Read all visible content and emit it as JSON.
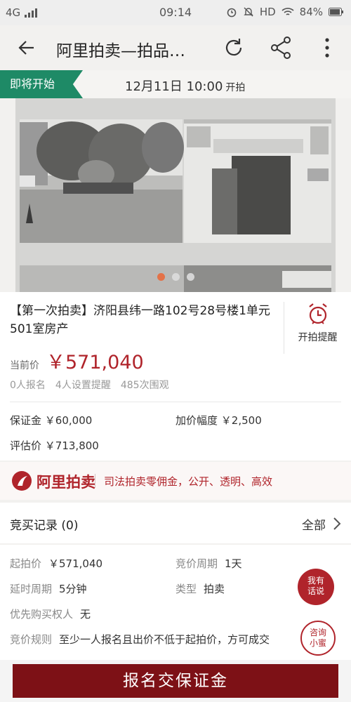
{
  "status_bar": {
    "network": "4G",
    "time": "09:14",
    "hd": "HD",
    "battery": "84%"
  },
  "title_bar": {
    "title": "阿里拍卖—拍品…"
  },
  "banner": {
    "badge": "即将开始",
    "start_time": "12月11日  10:00",
    "start_suffix": "开拍"
  },
  "lot": {
    "title": "【第一次拍卖】济阳县纬一路102号28号楼1单元501室房产",
    "remind_label": "开拍提醒",
    "current_price_label": "当前价",
    "current_price": "￥571,040",
    "stats": [
      "0人报名",
      "4人设置提醒",
      "485次围观"
    ],
    "deposit_label": "保证金",
    "deposit": "￥60,000",
    "increment_label": "加价幅度",
    "increment": "￥2,500",
    "appraisal_label": "评估价",
    "appraisal": "￥713,800",
    "photo_count": 3,
    "photo_index": 1
  },
  "brand": {
    "name": "阿里拍卖",
    "slogan": "司法拍卖零佣金，公开、透明、高效"
  },
  "records": {
    "title": "竞买记录",
    "count": "(0)",
    "all": "全部"
  },
  "details": {
    "start_price_label": "起拍价",
    "start_price": "￥571,040",
    "cycle_label": "竞价周期",
    "cycle": "1天",
    "delay_label": "延时周期",
    "delay": "5分钟",
    "type_label": "类型",
    "type": "拍卖",
    "priority_label": "优先购买权人",
    "priority": "无",
    "rule_label": "竞价规则",
    "rule": "至少一人报名且出价不低于起拍价，方可成交"
  },
  "float_buttons": {
    "chat": "我有话说",
    "consult": "咨询小蜜"
  },
  "cta": {
    "label": "报名交保证金"
  },
  "colors": {
    "brand_red": "#b0242b",
    "badge_green": "#1e8a66",
    "cta": "#7d1116"
  }
}
